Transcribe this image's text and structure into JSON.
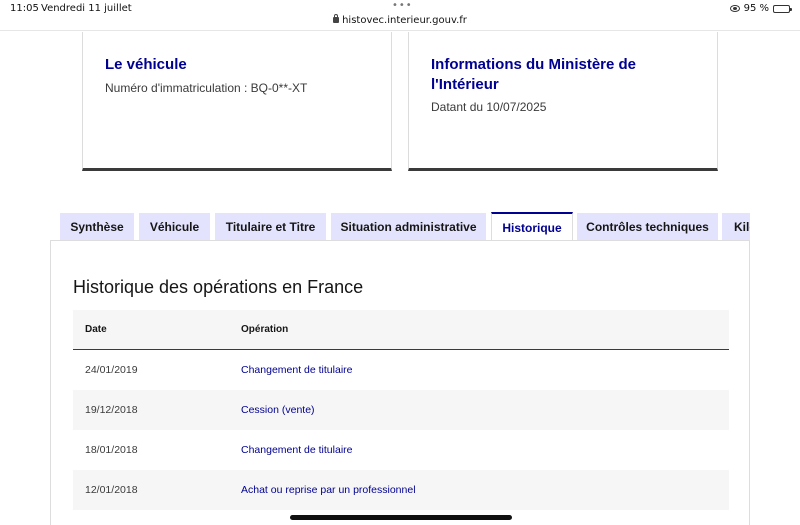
{
  "status_bar": {
    "time": "11:05",
    "date": "Vendredi 11 juillet",
    "url": "histovec.interieur.gouv.fr",
    "battery": "95 %",
    "battery_level": 0.95
  },
  "cards": [
    {
      "title": "Le véhicule",
      "text": "Numéro d'immatriculation : BQ-0**-XT"
    },
    {
      "title": "Informations du Ministère de l'Intérieur",
      "text": "Datant du 10/07/2025"
    }
  ],
  "tabs": [
    {
      "label": "Synthèse",
      "active": false
    },
    {
      "label": "Véhicule",
      "active": false
    },
    {
      "label": "Titulaire et Titre",
      "active": false
    },
    {
      "label": "Situation administrative",
      "active": false
    },
    {
      "label": "Historique",
      "active": true
    },
    {
      "label": "Contrôles techniques",
      "active": false
    },
    {
      "label": "Kilométrage",
      "active": false
    }
  ],
  "history": {
    "title": "Historique des opérations en France",
    "columns": {
      "date": "Date",
      "operation": "Opération"
    },
    "rows": [
      {
        "date": "24/01/2019",
        "operation": "Changement de titulaire"
      },
      {
        "date": "19/12/2018",
        "operation": "Cession (vente)"
      },
      {
        "date": "18/01/2018",
        "operation": "Changement de titulaire"
      },
      {
        "date": "12/01/2018",
        "operation": "Achat ou reprise par un professionnel"
      }
    ]
  },
  "colors": {
    "primary": "#000091",
    "tab_bg": "#e3e3fd",
    "text": "#161616"
  }
}
